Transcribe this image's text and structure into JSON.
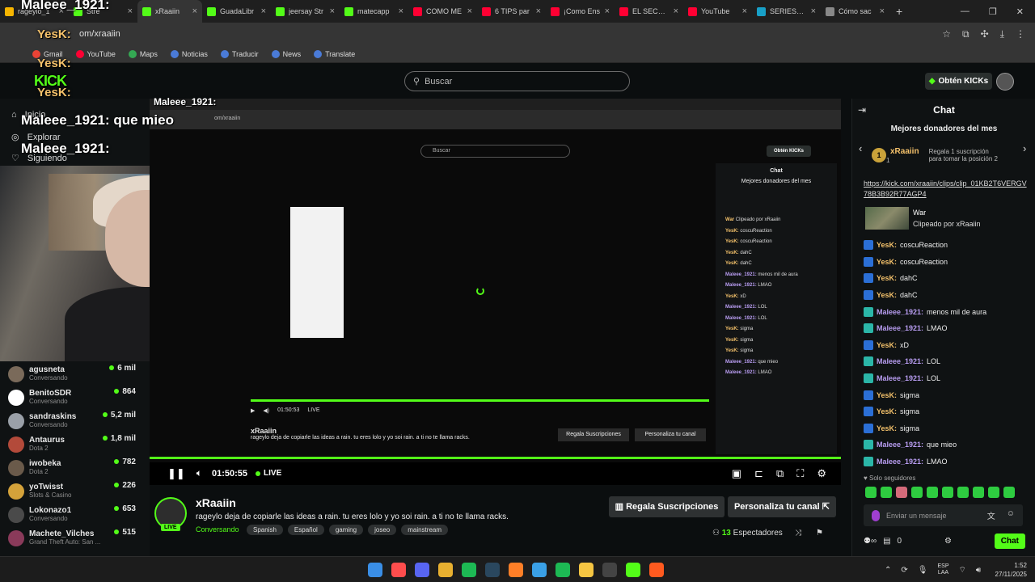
{
  "browser": {
    "tabs": [
      {
        "label": "rageylo_1",
        "color": "#f7b500"
      },
      {
        "label": "Stre",
        "color": "#53fc18"
      },
      {
        "label": "xRaaiin",
        "color": "#53fc18",
        "active": true
      },
      {
        "label": "GuadaLibr",
        "color": "#53fc18"
      },
      {
        "label": "jeersay Str",
        "color": "#53fc18"
      },
      {
        "label": "matecapp",
        "color": "#53fc18"
      },
      {
        "label": "COMO ME",
        "color": "#ff0033"
      },
      {
        "label": "6 TIPS par",
        "color": "#ff0033"
      },
      {
        "label": "¡Como Ens",
        "color": "#ff0033"
      },
      {
        "label": "EL SECRET",
        "color": "#ff0033"
      },
      {
        "label": "YouTube",
        "color": "#ff0033"
      },
      {
        "label": "SERIESFLI",
        "color": "#18a0c8"
      },
      {
        "label": "Cómo sac",
        "color": "#888888"
      }
    ],
    "url": "om/xraaiin",
    "bookmarks": [
      "Gmail",
      "YouTube",
      "Maps",
      "Noticias",
      "Traducir",
      "News",
      "Translate"
    ]
  },
  "overlay": {
    "kick_tag": "KICK",
    "yesk_1": "YesK:",
    "yesk_2": "YesK:",
    "yesk_3": "YesK:",
    "maleee_1": "Maleee_1921:",
    "maleee_2": "Maleee_1921: que mieo",
    "maleee_3": "Maleee_1921:",
    "maleee_4": "Maleee_1921:"
  },
  "header": {
    "search_placeholder": "Buscar",
    "get_kicks": "Obtén KICKs"
  },
  "sidebar": {
    "nav": [
      "Inicio",
      "Explorar",
      "Siguiendo"
    ],
    "channels": [
      {
        "name": "agusneta",
        "category": "Conversando",
        "viewers": "6 mil",
        "color": "#7a6a5a"
      },
      {
        "name": "BenitoSDR",
        "category": "Conversando",
        "viewers": "864",
        "color": "#ffffff"
      },
      {
        "name": "sandraskins",
        "category": "Conversando",
        "viewers": "5,2 mil",
        "color": "#9aa0a8"
      },
      {
        "name": "Antaurus",
        "category": "Dota 2",
        "viewers": "1,8 mil",
        "color": "#b34a3a"
      },
      {
        "name": "iwobeka",
        "category": "Dota 2",
        "viewers": "782",
        "color": "#6a5a4a"
      },
      {
        "name": "yoTwisst",
        "category": "Slots & Casino",
        "viewers": "226",
        "color": "#d4a23a"
      },
      {
        "name": "Lokonazo1",
        "category": "Conversando",
        "viewers": "653",
        "color": "#4a4a4a"
      },
      {
        "name": "Machete_Vilches",
        "category": "Grand Theft Auto: San ...",
        "viewers": "515",
        "color": "#8a3a5a"
      }
    ]
  },
  "nested": {
    "url": "om/xraaiin",
    "search": "Buscar",
    "get_kicks": "Obtén KICKs",
    "chat_title": "Chat",
    "donors": "Mejores donadores del mes",
    "lines": [
      {
        "u": "War",
        "t": "Clipeado por xRaaiin",
        "m": false
      },
      {
        "u": "YesK:",
        "t": "coscuReaction",
        "m": false
      },
      {
        "u": "YesK:",
        "t": "coscuReaction",
        "m": false
      },
      {
        "u": "YesK:",
        "t": "dahC",
        "m": false
      },
      {
        "u": "YesK:",
        "t": "dahC",
        "m": false
      },
      {
        "u": "Maleee_1921:",
        "t": "menos mil de aura",
        "m": true
      },
      {
        "u": "Maleee_1921:",
        "t": "LMAO",
        "m": true
      },
      {
        "u": "YesK:",
        "t": "xD",
        "m": false
      },
      {
        "u": "Maleee_1921:",
        "t": "LOL",
        "m": true
      },
      {
        "u": "Maleee_1921:",
        "t": "LOL",
        "m": true
      },
      {
        "u": "YesK:",
        "t": "sigma",
        "m": false
      },
      {
        "u": "YesK:",
        "t": "sigma",
        "m": false
      },
      {
        "u": "YesK:",
        "t": "sigma",
        "m": false
      },
      {
        "u": "Maleee_1921:",
        "t": "que mieo",
        "m": true
      },
      {
        "u": "Maleee_1921:",
        "t": "LMAO",
        "m": true
      }
    ],
    "time": "01:50:53",
    "live": "LIVE",
    "channel": "xRaaiin",
    "title": "rageylo deja de copiarle las ideas a rain. tu eres lolo y yo soi rain. a ti no te llama racks.",
    "gift": "Regala Suscripciones",
    "customize": "Personaliza tu canal",
    "viewers": "Espectadores"
  },
  "player": {
    "time": "01:50:55",
    "live": "LIVE"
  },
  "stream": {
    "channel": "xRaaiin",
    "live_badge": "LIVE",
    "title": "rageylo deja de copiarle las ideas a rain. tu eres lolo y yo soi rain. a ti no te llama racks.",
    "category": "Conversando",
    "tags": [
      "Spanish",
      "Español",
      "gaming",
      "joseo",
      "mainstream"
    ],
    "gift_button": "Regala Suscripciones",
    "customize_button": "Personaliza tu canal",
    "viewer_count": "13",
    "viewer_label": "Espectadores"
  },
  "chat": {
    "title": "Chat",
    "donors_title": "Mejores donadores del mes",
    "donor_name": "xRaaiin",
    "donor_amount": "1",
    "donor_message": "Regala 1 suscripción para tomar la posición 2",
    "clip_link": "https://kick.com/xraaiin/clips/clip_01KB2T6VERGV78B3B92R77AGP4",
    "clip_title": "War",
    "clip_by": "Clipeado por xRaaiin",
    "messages": [
      {
        "user": "YesK:",
        "text": "coscuReaction",
        "type": "yk"
      },
      {
        "user": "YesK:",
        "text": "coscuReaction",
        "type": "yk"
      },
      {
        "user": "YesK:",
        "text": "dahC",
        "type": "yk"
      },
      {
        "user": "YesK:",
        "text": "dahC",
        "type": "yk"
      },
      {
        "user": "Maleee_1921:",
        "text": "menos mil de aura",
        "type": "ml"
      },
      {
        "user": "Maleee_1921:",
        "text": "LMAO",
        "type": "ml"
      },
      {
        "user": "YesK:",
        "text": "xD",
        "type": "yk"
      },
      {
        "user": "Maleee_1921:",
        "text": "LOL",
        "type": "ml"
      },
      {
        "user": "Maleee_1921:",
        "text": "LOL",
        "type": "ml"
      },
      {
        "user": "YesK:",
        "text": "sigma",
        "type": "yk"
      },
      {
        "user": "YesK:",
        "text": "sigma",
        "type": "yk"
      },
      {
        "user": "YesK:",
        "text": "sigma",
        "type": "yk"
      },
      {
        "user": "Maleee_1921:",
        "text": "que mieo",
        "type": "ml"
      },
      {
        "user": "Maleee_1921:",
        "text": "LMAO",
        "type": "ml"
      }
    ],
    "followers_only": "Solo seguidores",
    "input_placeholder": "Enviar un mensaje",
    "kicks_count": "0",
    "send_button": "Chat"
  },
  "taskbar": {
    "lang_line1": "ESP",
    "lang_line2": "LAA",
    "time": "1:52",
    "date": "27/11/2025"
  }
}
